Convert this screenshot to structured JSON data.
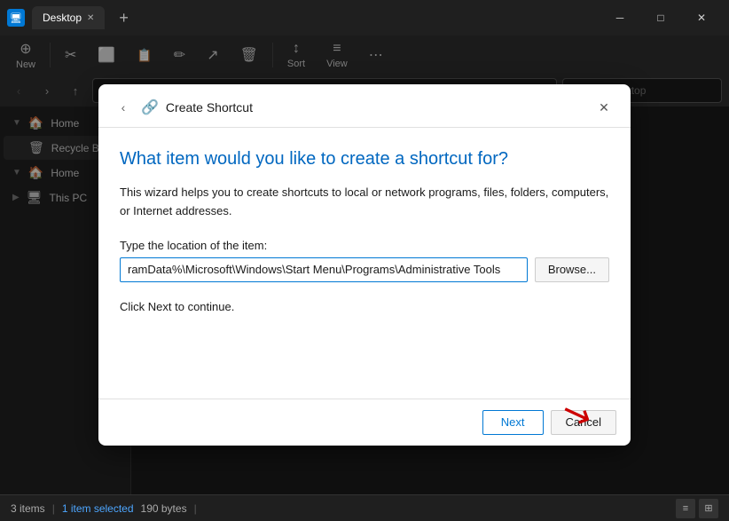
{
  "titlebar": {
    "icon_label": "D",
    "tab_label": "Desktop",
    "close_label": "✕",
    "minimize_label": "─",
    "maximize_label": "□",
    "new_tab_label": "+"
  },
  "toolbar": {
    "new_label": "New",
    "new_icon": "⊕",
    "cut_icon": "✂",
    "copy_icon": "⬜",
    "paste_icon": "📋",
    "rename_icon": "✏",
    "share_icon": "↗",
    "delete_icon": "🗑",
    "sort_label": "Sort",
    "sort_icon": "↕",
    "view_label": "View",
    "view_icon": "≡",
    "more_icon": "⋯"
  },
  "address": {
    "search_placeholder": "Search Desktop"
  },
  "sidebar": {
    "home_label": "Home",
    "recycle_bin_label": "Recycle Bin",
    "home2_label": "Home",
    "this_pc_label": "This PC"
  },
  "statusbar": {
    "items_count": "3 items",
    "selected_text": "1 item selected",
    "size": "190 bytes"
  },
  "dialog": {
    "title": "Create Shortcut",
    "heading": "What item would you like to create a shortcut for?",
    "desc": "This wizard helps you to create shortcuts to local or network programs, files, folders, computers, or Internet addresses.",
    "location_label": "Type the location of the item:",
    "location_value": "ramData%\\Microsoft\\Windows\\Start Menu\\Programs\\Administrative Tools",
    "browse_label": "Browse...",
    "hint": "Click Next to continue.",
    "next_label": "Next",
    "cancel_label": "Cancel"
  }
}
